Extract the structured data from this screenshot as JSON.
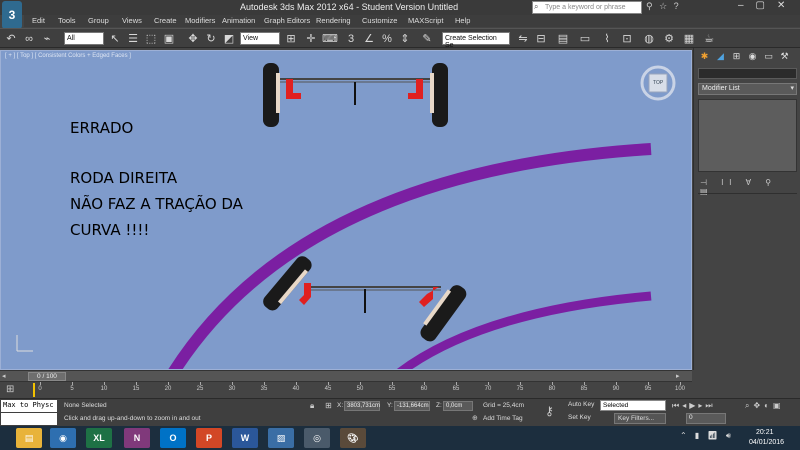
{
  "window": {
    "title": "Autodesk 3ds Max  2012 x64  -  Student Version    Untitled",
    "app_logo": "3",
    "search_placeholder": "Type a keyword or phrase"
  },
  "menu": [
    "Edit",
    "Tools",
    "Group",
    "Views",
    "Create",
    "Modifiers",
    "Animation",
    "Graph Editors",
    "Rendering",
    "Customize",
    "MAXScript",
    "Help"
  ],
  "toolbar": {
    "filter_dropdown": "All",
    "view_dropdown": "View",
    "named_selection": "Create Selection Se",
    "angle_snap": "3"
  },
  "viewport": {
    "label": "[ + ] [ Top ] [ Consistent Colors + Edged Faces ]",
    "viewcube_label": "TOP",
    "overlay": {
      "line1": "ERRADO",
      "line2": "RODA DIREITA",
      "line3": "NÃO FAZ A TRAÇÃO DA",
      "line4": "CURVA !!!!"
    },
    "colors": {
      "background": "#7f9bcb",
      "road": "#7b1fa2",
      "wheel": "#1a1a1a",
      "bracket": "#e02020"
    }
  },
  "command_panel": {
    "modifier_list": "Modifier List"
  },
  "timeline": {
    "slider_label": "0 / 100",
    "ticks": [
      "0",
      "5",
      "10",
      "15",
      "20",
      "25",
      "30",
      "35",
      "40",
      "45",
      "50",
      "55",
      "60",
      "65",
      "70",
      "75",
      "80",
      "85",
      "90",
      "95",
      "100"
    ]
  },
  "status": {
    "maxscript": "Max to Physc",
    "selection": "None Selected",
    "prompt": "Click and drag up-and-down to zoom in and out",
    "x_label": "X:",
    "x_value": "3803,731cm",
    "y_label": "Y:",
    "y_value": "-131,664cm",
    "z_label": "Z:",
    "z_value": "0,0cm",
    "grid": "Grid = 25,4cm",
    "add_time_tag": "Add Time Tag",
    "auto_key": "Auto Key",
    "set_key": "Set Key",
    "selected_dropdown": "Selected",
    "key_filters": "Key Filters...",
    "frame": "0"
  },
  "taskbar": {
    "apps": [
      "XL",
      "N",
      "O",
      "P",
      "W"
    ],
    "time": "20:21",
    "date": "04/01/2016"
  }
}
